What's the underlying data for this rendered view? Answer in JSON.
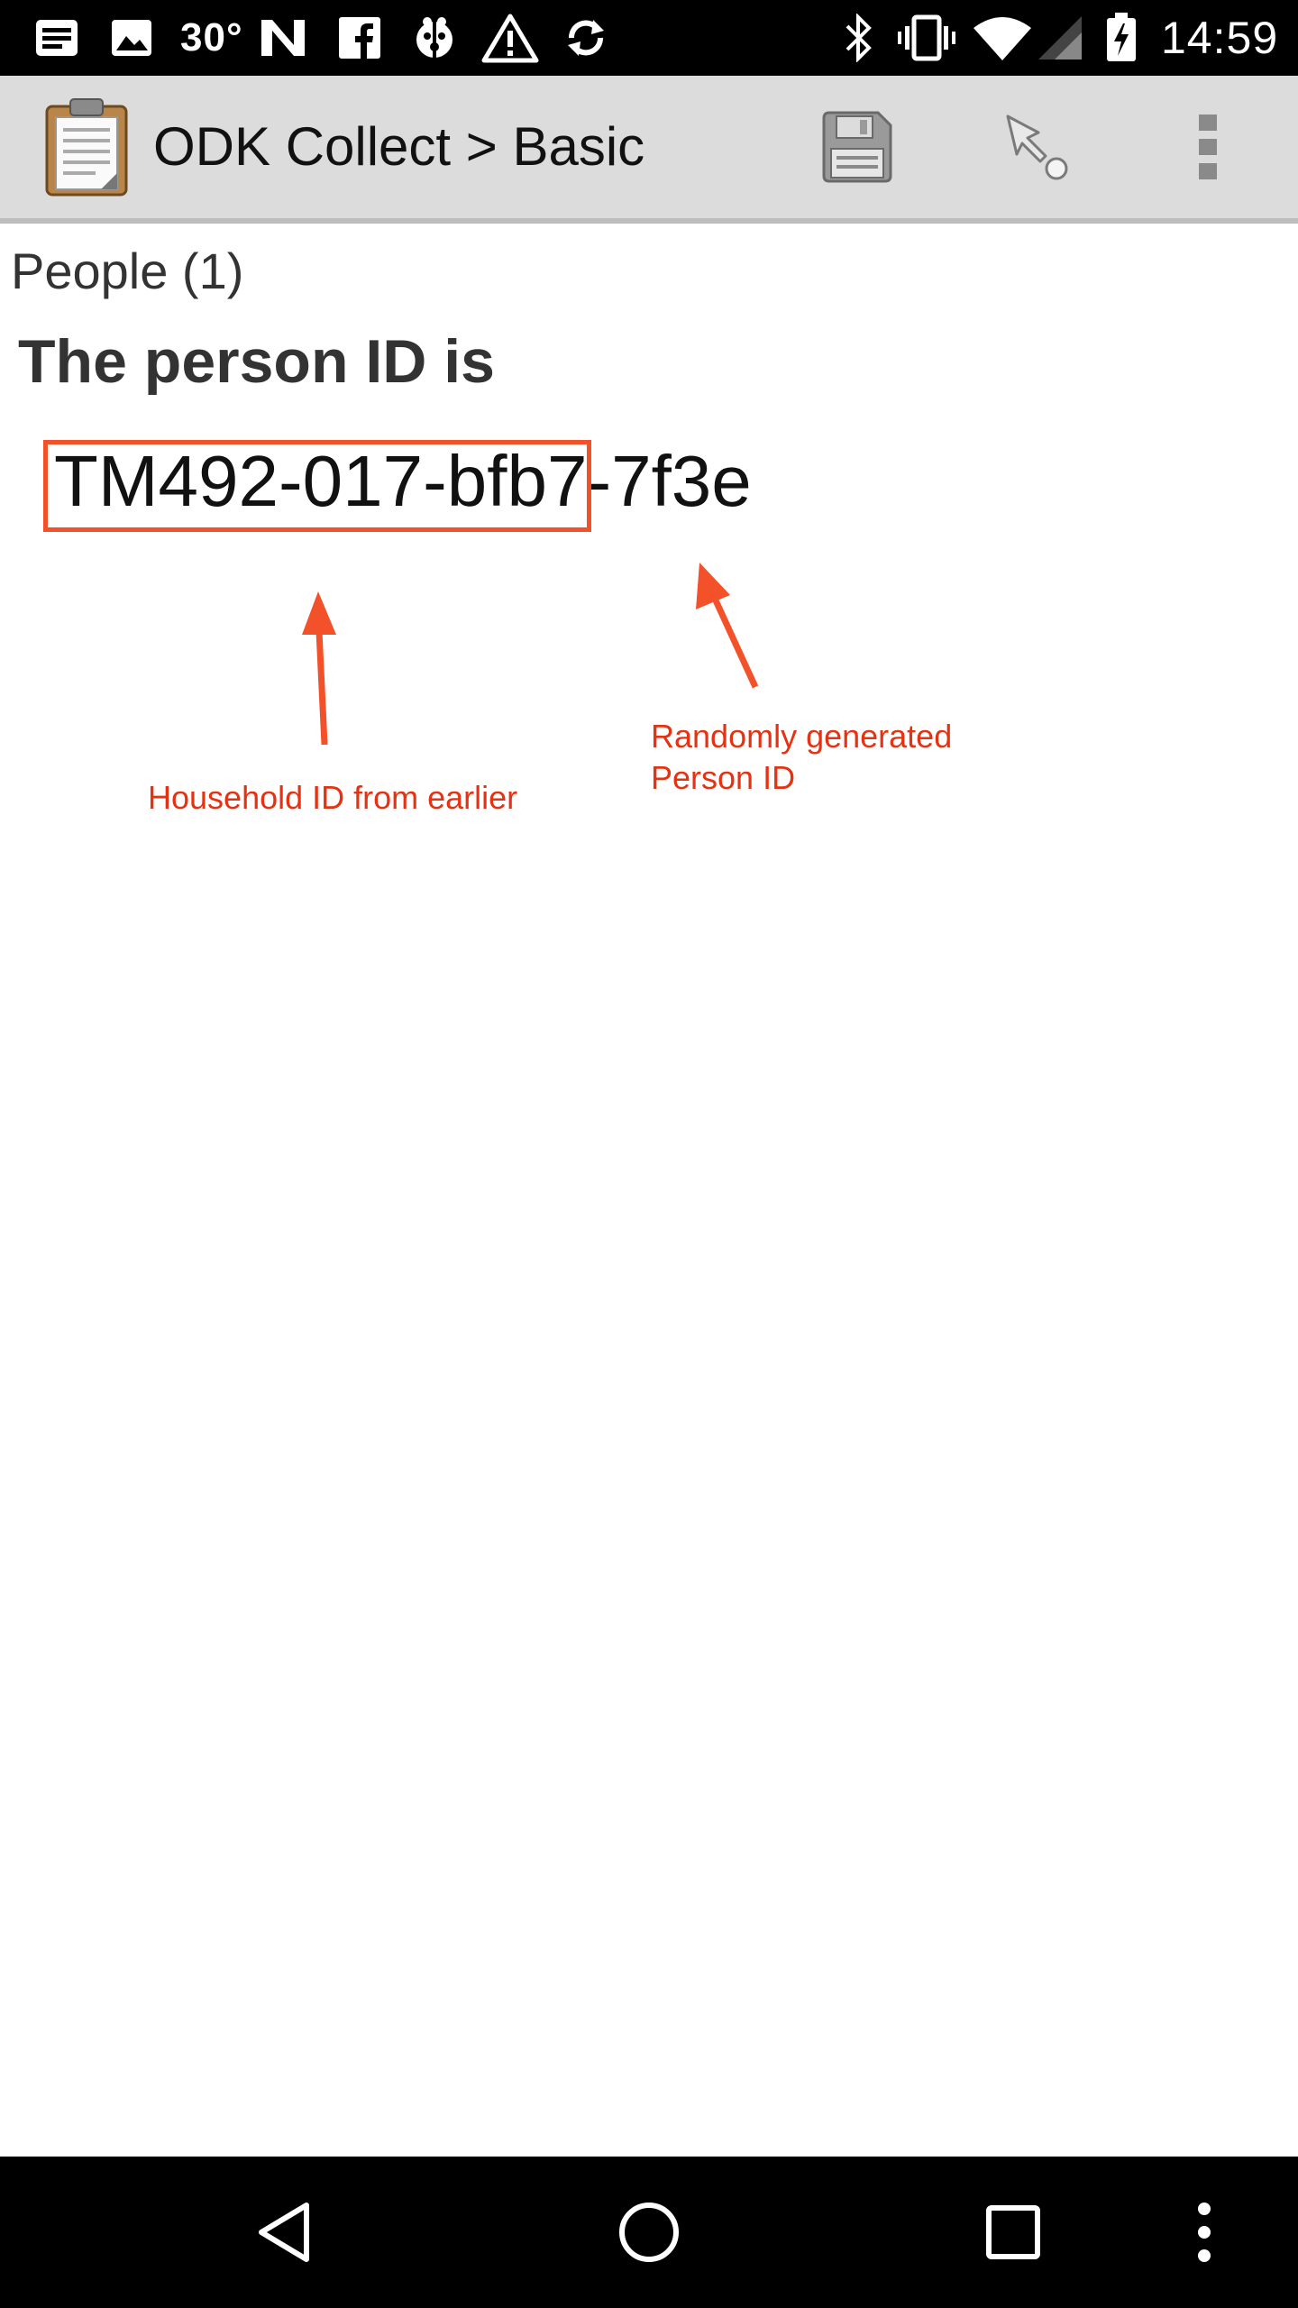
{
  "status_bar": {
    "temperature": "30°",
    "time": "14:59",
    "icons": [
      "notification-icon",
      "image-icon",
      "n-app-icon",
      "facebook-icon",
      "bug-icon",
      "warning-icon",
      "sync-icon",
      "bluetooth-icon",
      "vibrate-icon",
      "wifi-icon",
      "signal-icon",
      "battery-charging-icon"
    ]
  },
  "action_bar": {
    "title": "ODK Collect > Basic",
    "icons": [
      "clipboard-app-icon",
      "save-icon",
      "go-to-icon",
      "overflow-menu-icon"
    ]
  },
  "form": {
    "group_label": "People (1)",
    "question_label": "The person ID is",
    "person_id": "TM492-017-bfb7-7f3e"
  },
  "annotations": {
    "household": "Household ID from earlier",
    "random_line1": "Randomly generated",
    "random_line2": "Person ID",
    "color": "#e53212"
  },
  "nav_bar": {
    "icons": [
      "back-icon",
      "home-icon",
      "recents-icon",
      "nav-menu-icon"
    ]
  }
}
